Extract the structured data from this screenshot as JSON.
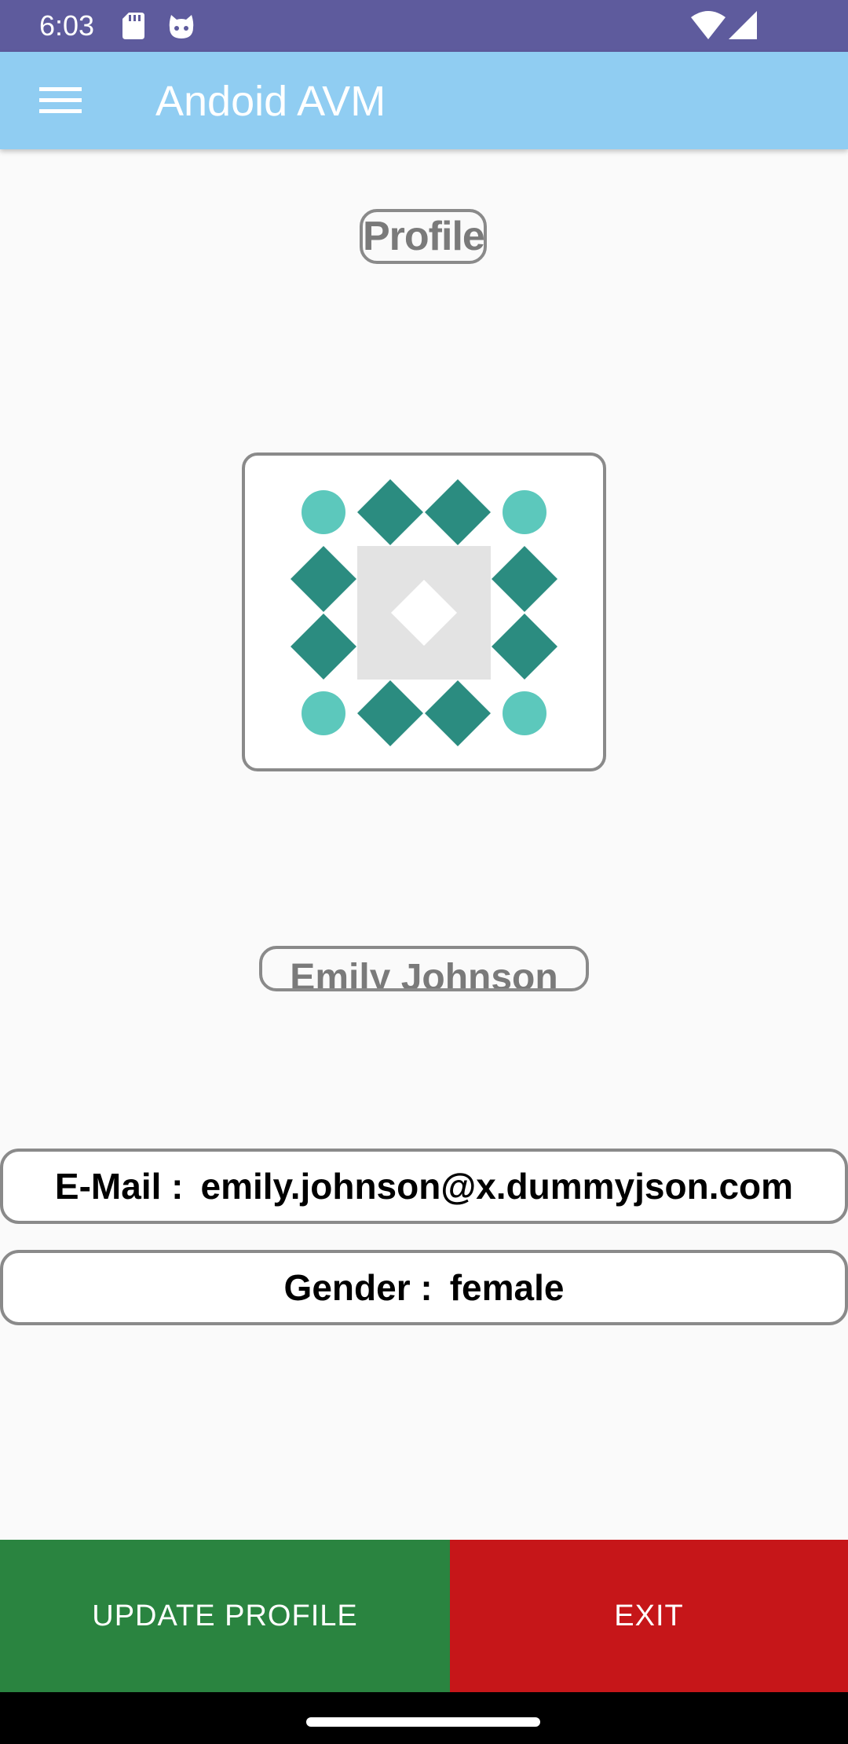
{
  "status_bar": {
    "time": "6:03",
    "icons": [
      "sd-card-icon",
      "cat-notification-icon",
      "wifi-icon",
      "signal-icon"
    ]
  },
  "app_bar": {
    "title": "Andoid AVM",
    "menu_icon": "hamburger-menu-icon",
    "color": "#90cdf2"
  },
  "profile": {
    "heading": "Profile",
    "avatar_icon": "identicon-avatar",
    "name": "Emily Johnson",
    "email_label": "E-Mail :",
    "email_value": "emily.johnson@x.dummyjson.com",
    "gender_label": "Gender :",
    "gender_value": "female"
  },
  "actions": {
    "update_label": "UPDATE PROFILE",
    "update_color": "#2a8440",
    "exit_label": "EXIT",
    "exit_color": "#c61619"
  },
  "colors": {
    "status_bar": "#5e5b9d",
    "identicon_dark": "#2b8c80",
    "identicon_light": "#5cc8bc",
    "identicon_center": "#e3e3e3"
  }
}
